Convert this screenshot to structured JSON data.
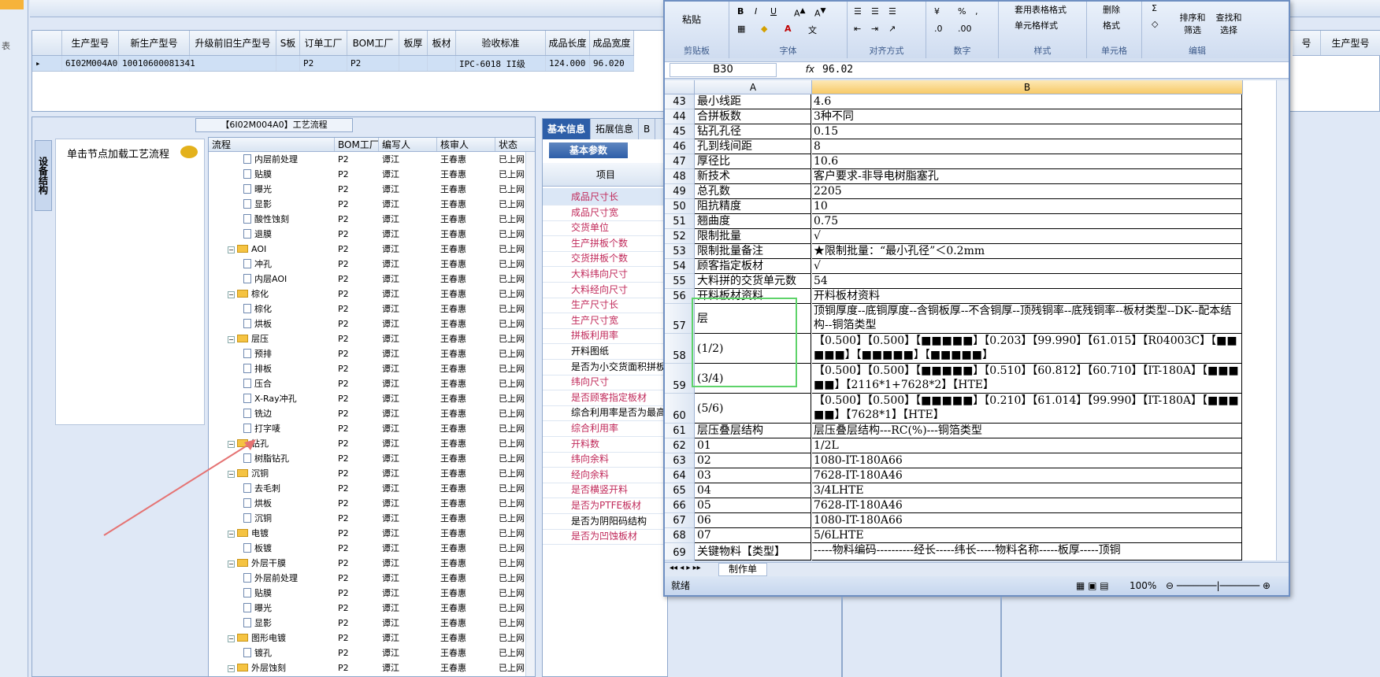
{
  "main_grid": {
    "headers": [
      "生产型号",
      "新生产型号",
      "升级前旧生产型号",
      "S板",
      "订单工厂",
      "BOM工厂",
      "板厚",
      "板材",
      "验收标准",
      "成品长度",
      "成品宽度"
    ],
    "row": [
      "6I02M004A0",
      "10010600081341",
      "",
      "",
      "P2",
      "P2",
      "",
      "",
      "IPC-6018 II级",
      "124.000",
      "96.020"
    ],
    "right_header": [
      "号",
      "生产型号"
    ]
  },
  "flow_panel": {
    "title": "【6I02M004A0】工艺流程",
    "vtab": "设备结构",
    "click_hint": "单击节点加载工艺流程"
  },
  "tree": {
    "headers": [
      "流程",
      "BOM工厂",
      "编写人",
      "核审人",
      "状态"
    ],
    "rows": [
      {
        "name": "内层前处理",
        "type": "doc",
        "indent": 2,
        "bom": "P2",
        "writer": "谭江",
        "reviewer": "王春惠",
        "status": "已上网"
      },
      {
        "name": "贴膜",
        "type": "doc",
        "indent": 2,
        "bom": "P2",
        "writer": "谭江",
        "reviewer": "王春惠",
        "status": "已上网"
      },
      {
        "name": "曝光",
        "type": "doc",
        "indent": 2,
        "bom": "P2",
        "writer": "谭江",
        "reviewer": "王春惠",
        "status": "已上网"
      },
      {
        "name": "显影",
        "type": "doc",
        "indent": 2,
        "bom": "P2",
        "writer": "谭江",
        "reviewer": "王春惠",
        "status": "已上网"
      },
      {
        "name": "酸性蚀刻",
        "type": "doc",
        "indent": 2,
        "bom": "P2",
        "writer": "谭江",
        "reviewer": "王春惠",
        "status": "已上网"
      },
      {
        "name": "退膜",
        "type": "doc",
        "indent": 2,
        "bom": "P2",
        "writer": "谭江",
        "reviewer": "王春惠",
        "status": "已上网"
      },
      {
        "name": "AOI",
        "type": "folder",
        "indent": 1,
        "bom": "P2",
        "writer": "谭江",
        "reviewer": "王春惠",
        "status": "已上网"
      },
      {
        "name": "冲孔",
        "type": "doc",
        "indent": 2,
        "bom": "P2",
        "writer": "谭江",
        "reviewer": "王春惠",
        "status": "已上网"
      },
      {
        "name": "内层AOI",
        "type": "doc",
        "indent": 2,
        "bom": "P2",
        "writer": "谭江",
        "reviewer": "王春惠",
        "status": "已上网"
      },
      {
        "name": "棕化",
        "type": "folder",
        "indent": 1,
        "bom": "P2",
        "writer": "谭江",
        "reviewer": "王春惠",
        "status": "已上网"
      },
      {
        "name": "棕化",
        "type": "doc",
        "indent": 2,
        "bom": "P2",
        "writer": "谭江",
        "reviewer": "王春惠",
        "status": "已上网"
      },
      {
        "name": "烘板",
        "type": "doc",
        "indent": 2,
        "bom": "P2",
        "writer": "谭江",
        "reviewer": "王春惠",
        "status": "已上网"
      },
      {
        "name": "层压",
        "type": "folder",
        "indent": 1,
        "bom": "P2",
        "writer": "谭江",
        "reviewer": "王春惠",
        "status": "已上网"
      },
      {
        "name": "预排",
        "type": "doc",
        "indent": 2,
        "bom": "P2",
        "writer": "谭江",
        "reviewer": "王春惠",
        "status": "已上网"
      },
      {
        "name": "排板",
        "type": "doc",
        "indent": 2,
        "bom": "P2",
        "writer": "谭江",
        "reviewer": "王春惠",
        "status": "已上网"
      },
      {
        "name": "压合",
        "type": "doc",
        "indent": 2,
        "bom": "P2",
        "writer": "谭江",
        "reviewer": "王春惠",
        "status": "已上网"
      },
      {
        "name": "X-Ray冲孔",
        "type": "doc",
        "indent": 2,
        "bom": "P2",
        "writer": "谭江",
        "reviewer": "王春惠",
        "status": "已上网"
      },
      {
        "name": "铣边",
        "type": "doc",
        "indent": 2,
        "bom": "P2",
        "writer": "谭江",
        "reviewer": "王春惠",
        "status": "已上网"
      },
      {
        "name": "打字唛",
        "type": "doc",
        "indent": 2,
        "bom": "P2",
        "writer": "谭江",
        "reviewer": "王春惠",
        "status": "已上网"
      },
      {
        "name": "钻孔",
        "type": "folder",
        "indent": 1,
        "bom": "P2",
        "writer": "谭江",
        "reviewer": "王春惠",
        "status": "已上网"
      },
      {
        "name": "树脂钻孔",
        "type": "doc",
        "indent": 2,
        "bom": "P2",
        "writer": "谭江",
        "reviewer": "王春惠",
        "status": "已上网"
      },
      {
        "name": "沉铜",
        "type": "folder",
        "indent": 1,
        "bom": "P2",
        "writer": "谭江",
        "reviewer": "王春惠",
        "status": "已上网"
      },
      {
        "name": "去毛刺",
        "type": "doc",
        "indent": 2,
        "bom": "P2",
        "writer": "谭江",
        "reviewer": "王春惠",
        "status": "已上网"
      },
      {
        "name": "烘板",
        "type": "doc",
        "indent": 2,
        "bom": "P2",
        "writer": "谭江",
        "reviewer": "王春惠",
        "status": "已上网"
      },
      {
        "name": "沉铜",
        "type": "doc",
        "indent": 2,
        "bom": "P2",
        "writer": "谭江",
        "reviewer": "王春惠",
        "status": "已上网"
      },
      {
        "name": "电镀",
        "type": "folder",
        "indent": 1,
        "bom": "P2",
        "writer": "谭江",
        "reviewer": "王春惠",
        "status": "已上网"
      },
      {
        "name": "板镀",
        "type": "doc",
        "indent": 2,
        "bom": "P2",
        "writer": "谭江",
        "reviewer": "王春惠",
        "status": "已上网"
      },
      {
        "name": "外层干膜",
        "type": "folder",
        "indent": 1,
        "bom": "P2",
        "writer": "谭江",
        "reviewer": "王春惠",
        "status": "已上网"
      },
      {
        "name": "外层前处理",
        "type": "doc",
        "indent": 2,
        "bom": "P2",
        "writer": "谭江",
        "reviewer": "王春惠",
        "status": "已上网"
      },
      {
        "name": "贴膜",
        "type": "doc",
        "indent": 2,
        "bom": "P2",
        "writer": "谭江",
        "reviewer": "王春惠",
        "status": "已上网"
      },
      {
        "name": "曝光",
        "type": "doc",
        "indent": 2,
        "bom": "P2",
        "writer": "谭江",
        "reviewer": "王春惠",
        "status": "已上网"
      },
      {
        "name": "显影",
        "type": "doc",
        "indent": 2,
        "bom": "P2",
        "writer": "谭江",
        "reviewer": "王春惠",
        "status": "已上网"
      },
      {
        "name": "图形电镀",
        "type": "folder",
        "indent": 1,
        "bom": "P2",
        "writer": "谭江",
        "reviewer": "王春惠",
        "status": "已上网"
      },
      {
        "name": "镀孔",
        "type": "doc",
        "indent": 2,
        "bom": "P2",
        "writer": "谭江",
        "reviewer": "王春惠",
        "status": "已上网"
      },
      {
        "name": "外层蚀刻",
        "type": "folder",
        "indent": 1,
        "bom": "P2",
        "writer": "谭江",
        "reviewer": "王春惠",
        "status": "已上网"
      }
    ]
  },
  "info_panel": {
    "tabs": [
      "基本信息",
      "拓展信息",
      "B"
    ],
    "sub_tab": "基本参数",
    "col_header": "项目",
    "items": [
      {
        "label": "成品尺寸长",
        "red": true
      },
      {
        "label": "成品尺寸宽",
        "red": true
      },
      {
        "label": "交货单位",
        "red": true
      },
      {
        "label": "生产拼板个数",
        "red": true
      },
      {
        "label": "交货拼板个数",
        "red": true
      },
      {
        "label": "大料纬向尺寸",
        "red": true
      },
      {
        "label": "大料经向尺寸",
        "red": true
      },
      {
        "label": "生产尺寸长",
        "red": true
      },
      {
        "label": "生产尺寸宽",
        "red": true
      },
      {
        "label": "拼板利用率",
        "red": true
      },
      {
        "label": "开料图纸",
        "red": false
      },
      {
        "label": "是否为小交货面积拼板",
        "red": false
      },
      {
        "label": "纬向尺寸",
        "red": true
      },
      {
        "label": "是否顾客指定板材",
        "red": true
      },
      {
        "label": "综合利用率是否为最高",
        "red": false
      },
      {
        "label": "综合利用率",
        "red": true
      },
      {
        "label": "开料数",
        "red": true
      },
      {
        "label": "纬向余料",
        "red": true
      },
      {
        "label": "经向余料",
        "red": true
      },
      {
        "label": "是否横竖开料",
        "red": true
      },
      {
        "label": "是否为PTFE板材",
        "red": true
      },
      {
        "label": "是否为阴阳码结构",
        "red": false
      },
      {
        "label": "是否为凹蚀板材",
        "red": true
      }
    ]
  },
  "excel": {
    "ribbon": {
      "paste": "粘贴",
      "clipboard": "剪贴板",
      "font": "字体",
      "align": "对齐方式",
      "number": "数字",
      "styles": "样式",
      "cells": "单元格",
      "edit": "编辑",
      "table_format": "套用表格格式",
      "cell_style": "单元格样式",
      "delete": "删除",
      "format": "格式",
      "sort": "排序和筛选",
      "find": "查找和选择"
    },
    "namebox": "B30",
    "fx": "fx",
    "formula": "96.02",
    "col_a": "A",
    "col_b": "B",
    "rows": [
      {
        "n": "43",
        "a": "最小线距",
        "b": "4.6"
      },
      {
        "n": "44",
        "a": "合拼板数",
        "b": "3种不同"
      },
      {
        "n": "45",
        "a": "钻孔孔径",
        "b": "0.15"
      },
      {
        "n": "46",
        "a": "孔到线间距",
        "b": "8"
      },
      {
        "n": "47",
        "a": "厚径比",
        "b": "10.6"
      },
      {
        "n": "48",
        "a": "新技术",
        "b": "客户要求-非导电树脂塞孔"
      },
      {
        "n": "49",
        "a": "总孔数",
        "b": "2205"
      },
      {
        "n": "50",
        "a": "阻抗精度",
        "b": "10"
      },
      {
        "n": "51",
        "a": "翘曲度",
        "b": "0.75"
      },
      {
        "n": "52",
        "a": "限制批量",
        "b": "√"
      },
      {
        "n": "53",
        "a": "限制批量备注",
        "b": "★限制批量：“最小孔径”＜0.2mm"
      },
      {
        "n": "54",
        "a": "顾客指定板材",
        "b": "√"
      },
      {
        "n": "55",
        "a": "大料拼的交货单元数",
        "b": "54"
      },
      {
        "n": "56",
        "a": "开料板材资料",
        "b": "开料板材资料"
      },
      {
        "n": "57",
        "a": "层",
        "b": "顶铜厚度--底铜厚度--含铜板厚--不含铜厚--顶残铜率--底残铜率--板材类型--DK--配本结构--铜箔类型"
      },
      {
        "n": "58",
        "a": "(1/2)",
        "b": "【0.500】【0.500】【■■■■■】【0.203】【99.990】【61.015】【R04003C】【■■■■■】【■■■■■】【■■■■■】"
      },
      {
        "n": "59",
        "a": "(3/4)",
        "b": "【0.500】【0.500】【■■■■■】【0.510】【60.812】【60.710】【IT-180A】【■■■■■】【2116*1+7628*2】【HTE】"
      },
      {
        "n": "60",
        "a": "(5/6)",
        "b": "【0.500】【0.500】【■■■■■】【0.210】【61.014】【99.990】【IT-180A】【■■■■■】【7628*1】【HTE】"
      },
      {
        "n": "61",
        "a": "层压叠层结构",
        "b": "层压叠层结构---RC(%)---铜箔类型"
      },
      {
        "n": "62",
        "a": "01",
        "b": "1/2L"
      },
      {
        "n": "63",
        "a": "02",
        "b": "1080-IT-180A66"
      },
      {
        "n": "64",
        "a": "03",
        "b": "7628-IT-180A46"
      },
      {
        "n": "65",
        "a": "04",
        "b": "3/4LHTE"
      },
      {
        "n": "66",
        "a": "05",
        "b": "7628-IT-180A46"
      },
      {
        "n": "67",
        "a": "06",
        "b": "1080-IT-180A66"
      },
      {
        "n": "68",
        "a": "07",
        "b": "5/6LHTE"
      },
      {
        "n": "69",
        "a": "关键物料【类型】",
        "b": "-----物料编码----------经长-----纬长-----物料名称-----板厚-----顶铜"
      }
    ],
    "sheet_tab": "制作单",
    "status": "就绪",
    "zoom": "100%"
  }
}
